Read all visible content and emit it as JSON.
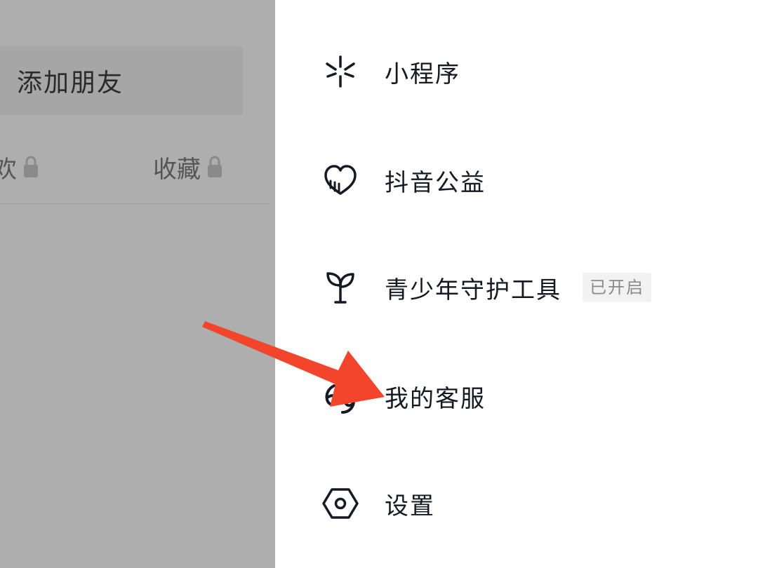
{
  "background_page": {
    "add_friend_label": "添加朋友",
    "tab_likes_label": "欢",
    "tab_favorites_label": "收藏"
  },
  "drawer": {
    "items": [
      {
        "label": "小程序",
        "icon": "mini-program-icon"
      },
      {
        "label": "抖音公益",
        "icon": "charity-heart-icon"
      },
      {
        "label": "青少年守护工具",
        "icon": "sprout-icon",
        "badge": "已开启"
      },
      {
        "label": "我的客服",
        "icon": "customer-service-icon"
      },
      {
        "label": "设置",
        "icon": "settings-hexagon-icon"
      }
    ]
  },
  "annotation": {
    "arrow_color": "#f2452b",
    "points_to": "我的客服"
  },
  "colors": {
    "overlay": "#aeaeae",
    "text_primary": "#161823",
    "badge_bg": "#f2f2f2",
    "badge_text": "#8a8a8a"
  }
}
